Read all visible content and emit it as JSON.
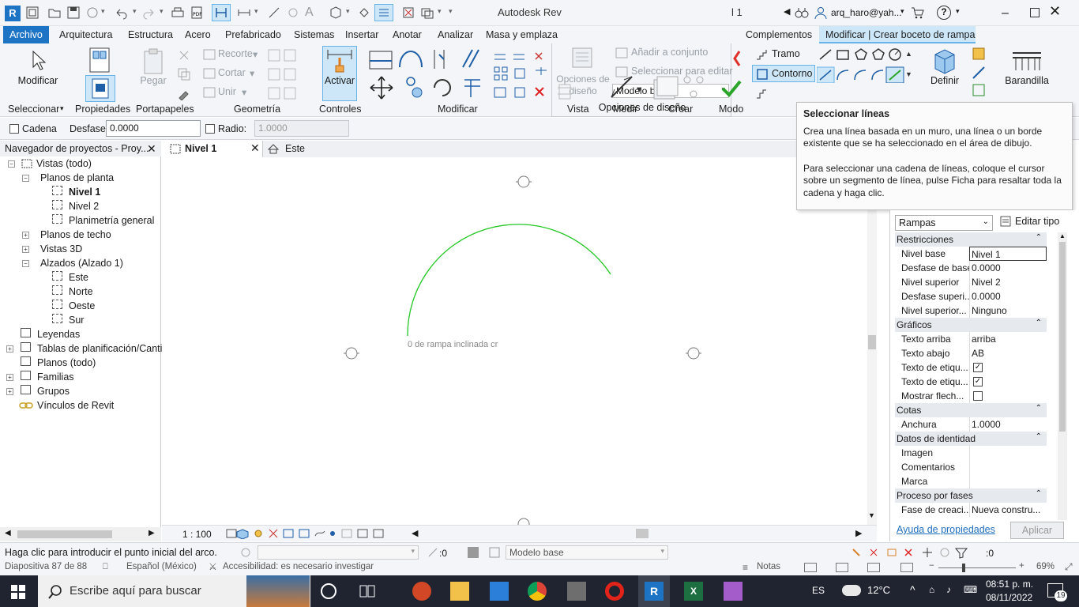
{
  "app": {
    "title": "Autodesk Rev",
    "level_fragment": "l 1",
    "user": "arq_haro@yah..."
  },
  "menu": {
    "items": [
      "Archivo",
      "Arquitectura",
      "Estructura",
      "Acero",
      "Prefabricado",
      "Sistemas",
      "Insertar",
      "Anotar",
      "Analizar",
      "Masa y emplaza",
      "Complementos",
      "Modificar | Crear boceto de rampa"
    ]
  },
  "ribbon": {
    "modificar": "Modificar",
    "pegar": "Pegar",
    "recorte": "Recorte",
    "cortar": "Cortar",
    "unir": "Unir",
    "activar": "Activar",
    "tramo": "Tramo",
    "contorno": "Contorno",
    "definir": "Definir",
    "barandilla": "Barandilla",
    "panels": {
      "seleccionar": "Seleccionar",
      "propiedades": "Propiedades",
      "portapapeles": "Portapapeles",
      "geometria": "Geometría",
      "controles": "Controles",
      "modificar": "Modificar",
      "vista": "Vista",
      "medir": "Medir",
      "crear": "Crear",
      "modo": "Modo"
    },
    "design_options": {
      "label": "Opciones de diseño",
      "title": "Opciones de\ndiseño",
      "add": "Añadir a conjunto",
      "select_edit": "Seleccionar para editar",
      "model": "Modelo base"
    }
  },
  "options_bar": {
    "cadena": "Cadena",
    "desfase_label": "Desfase:",
    "desfase_value": "0.0000",
    "radio_label": "Radio:",
    "radio_value": "1.0000"
  },
  "browser": {
    "title": "Navegador de proyectos - Proy...",
    "items": {
      "vistas": "Vistas (todo)",
      "planos_planta": "Planos de planta",
      "nivel1": "Nivel 1",
      "nivel2": "Nivel 2",
      "planimetria": "Planimetría general",
      "planos_techo": "Planos de techo",
      "vistas3d": "Vistas 3D",
      "alzados": "Alzados (Alzado 1)",
      "este": "Este",
      "norte": "Norte",
      "oeste": "Oeste",
      "sur": "Sur",
      "leyendas": "Leyendas",
      "tablas": "Tablas de planificación/Cantid",
      "planos": "Planos (todo)",
      "familias": "Familias",
      "grupos": "Grupos",
      "vinculos": "Vínculos de Revit"
    }
  },
  "tabs": {
    "active": "Nivel 1",
    "other": "Este"
  },
  "canvas": {
    "label": "0 de rampa inclinada cr"
  },
  "view_control": {
    "scale": "1 : 100"
  },
  "tooltip": {
    "title": "Seleccionar líneas",
    "p1": "Crea una línea basada en un muro, una línea o un borde existente que se ha seleccionado en el área de dibujo.",
    "p2": "Para seleccionar una cadena de líneas, coloque el cursor sobre un segmento de línea, pulse Ficha para resaltar toda la cadena y haga clic."
  },
  "properties": {
    "type": "Rampas",
    "edit_type": "Editar tipo",
    "restricciones": "Restricciones",
    "nivel_base": [
      "Nivel base",
      "Nivel 1"
    ],
    "desfase_base": [
      "Desfase de base",
      "0.0000"
    ],
    "nivel_superior": [
      "Nivel superior",
      "Nivel 2"
    ],
    "desfase_superior": [
      "Desfase superi...",
      "0.0000"
    ],
    "nivel_superior2": [
      "Nivel superior...",
      "Ninguno"
    ],
    "graficos": "Gráficos",
    "texto_arriba": [
      "Texto arriba",
      "arriba"
    ],
    "texto_abajo": [
      "Texto abajo",
      "AB"
    ],
    "texto_etiq1": "Texto de etiqu...",
    "texto_etiq2": "Texto de etiqu...",
    "mostrar_flecha": "Mostrar flech...",
    "cotas": "Cotas",
    "anchura": [
      "Anchura",
      "1.0000"
    ],
    "datos_identidad": "Datos de identidad",
    "imagen": "Imagen",
    "comentarios": "Comentarios",
    "marca": "Marca",
    "proceso_fases": "Proceso por fases",
    "fase_creacion": [
      "Fase de creaci...",
      "Nueva constru..."
    ],
    "help": "Ayuda de propiedades",
    "apply": "Aplicar"
  },
  "status": {
    "message": "Haga clic para introducir el punto inicial del arco.",
    "zero": ":0",
    "model": "Modelo base",
    "filter": ":0"
  },
  "ppt": {
    "slide": "Diapositiva 87 de 88",
    "lang": "Español (México)",
    "access": "Accesibilidad: es necesario investigar",
    "notes": "Notas",
    "zoom": "69%"
  },
  "taskbar": {
    "search": "Escribe aquí para buscar",
    "lang": "ES",
    "temp": "12°C",
    "time": "08:51 p. m.",
    "date": "08/11/2022",
    "badge": "19"
  },
  "colors": {
    "accent": "#1e74c4",
    "active_tab": "#cde7f8",
    "sketch_line": "#22c722",
    "finish_check": "#2aa52a",
    "cancel": "#e0302a"
  }
}
